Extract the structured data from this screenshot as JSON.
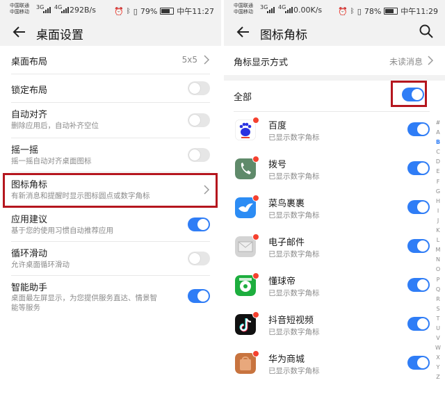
{
  "left": {
    "status": {
      "carrier1": "中国联通",
      "carrier2": "中国移动",
      "net": "3G",
      "net2": "4G",
      "speed": "292B/s",
      "battery": "79%",
      "time": "中午11:27"
    },
    "header": {
      "title": "桌面设置"
    },
    "items": [
      {
        "title": "桌面布局",
        "value": "5x5"
      },
      {
        "title": "锁定布局",
        "toggle": false
      },
      {
        "title": "自动对齐",
        "subtitle": "删除应用后，自动补齐空位",
        "toggle": false
      },
      {
        "title": "摇一摇",
        "subtitle": "摇一摇自动对齐桌面图标",
        "toggle": false
      },
      {
        "title": "图标角标",
        "subtitle": "有新消息和提醒时显示图标圆点或数字角标"
      },
      {
        "title": "应用建议",
        "subtitle": "基于您的使用习惯自动推荐应用",
        "toggle": true
      },
      {
        "title": "循环滑动",
        "subtitle": "允许桌面循环滑动",
        "toggle": false
      },
      {
        "title": "智能助手",
        "subtitle_line1": "桌面最左屏显示，为您提供服务直达、情景智",
        "subtitle_line2": "能等服务",
        "toggle": true
      }
    ]
  },
  "right": {
    "status": {
      "carrier1": "中国联通",
      "carrier2": "中国移动",
      "net": "3G",
      "net2": "4G",
      "speed": "0.00K/s",
      "battery": "78%",
      "time": "中午11:29"
    },
    "header": {
      "title": "图标角标"
    },
    "display_mode": {
      "label": "角标显示方式",
      "value": "未读消息"
    },
    "all": {
      "label": "全部",
      "toggle": true
    },
    "apps": [
      {
        "name": "百度",
        "sub": "已显示数字角标",
        "icon": "baidu-icon",
        "color": "#ffffff"
      },
      {
        "name": "拨号",
        "sub": "已显示数字角标",
        "icon": "phone-icon",
        "color": "#5f8a6a"
      },
      {
        "name": "菜鸟裹裹",
        "sub": "已显示数字角标",
        "icon": "cainiao-icon",
        "color": "#2c8cf4"
      },
      {
        "name": "电子邮件",
        "sub": "已显示数字角标",
        "icon": "mail-icon",
        "color": "#cfcfcf"
      },
      {
        "name": "懂球帝",
        "sub": "已显示数字角标",
        "icon": "dongqiudi-icon",
        "color": "#1dae3e"
      },
      {
        "name": "抖音短视频",
        "sub": "已显示数字角标",
        "icon": "douyin-icon",
        "color": "#111111"
      },
      {
        "name": "华为商城",
        "sub": "已显示数字角标",
        "icon": "vmall-icon",
        "color": "#c8743f"
      }
    ],
    "alphabet": [
      "#",
      "A",
      "B",
      "C",
      "D",
      "E",
      "F",
      "G",
      "H",
      "I",
      "J",
      "K",
      "L",
      "M",
      "N",
      "O",
      "P",
      "Q",
      "R",
      "S",
      "T",
      "U",
      "V",
      "W",
      "X",
      "Y",
      "Z"
    ],
    "alphabet_active": "B"
  },
  "colors": {
    "accent": "#2f7df6",
    "highlight": "#b5161e",
    "badge": "#f5412f"
  }
}
